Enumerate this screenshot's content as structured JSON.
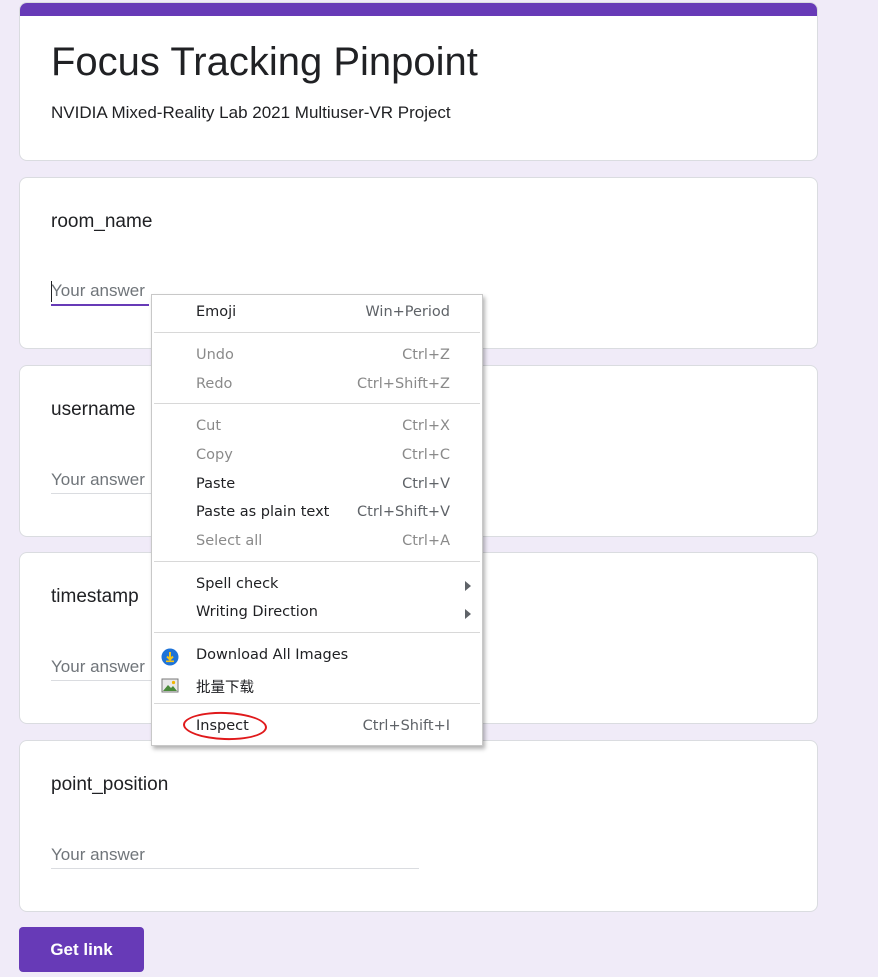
{
  "form": {
    "title": "Focus Tracking Pinpoint",
    "description": "NVIDIA Mixed-Reality Lab 2021 Multiuser-VR Project",
    "accent_color": "#673ab7",
    "background_color": "#f0ebf8"
  },
  "questions": [
    {
      "label": "room_name",
      "placeholder": "Your answer",
      "focused": true
    },
    {
      "label": "username",
      "placeholder": "Your answer",
      "focused": false
    },
    {
      "label": "timestamp",
      "placeholder": "Your answer",
      "focused": false
    },
    {
      "label": "point_position",
      "placeholder": "Your answer",
      "focused": false
    }
  ],
  "get_link_button": {
    "label": "Get link"
  },
  "context_menu": {
    "emoji": {
      "label": "Emoji",
      "shortcut": "Win+Period"
    },
    "undo": {
      "label": "Undo",
      "shortcut": "Ctrl+Z",
      "enabled": false
    },
    "redo": {
      "label": "Redo",
      "shortcut": "Ctrl+Shift+Z",
      "enabled": false
    },
    "cut": {
      "label": "Cut",
      "shortcut": "Ctrl+X",
      "enabled": false
    },
    "copy": {
      "label": "Copy",
      "shortcut": "Ctrl+C",
      "enabled": false
    },
    "paste": {
      "label": "Paste",
      "shortcut": "Ctrl+V",
      "enabled": true
    },
    "paste_plain": {
      "label": "Paste as plain text",
      "shortcut": "Ctrl+Shift+V",
      "enabled": true
    },
    "select_all": {
      "label": "Select all",
      "shortcut": "Ctrl+A",
      "enabled": false
    },
    "spell_check": {
      "label": "Spell check",
      "submenu": true
    },
    "writing_direction": {
      "label": "Writing Direction",
      "submenu": true
    },
    "download_images": {
      "label": "Download All Images",
      "icon": "download-icon"
    },
    "batch_download": {
      "label": "批量下载",
      "icon": "image-icon"
    },
    "inspect": {
      "label": "Inspect",
      "shortcut": "Ctrl+Shift+I",
      "highlight_color": "#e0191b"
    }
  }
}
